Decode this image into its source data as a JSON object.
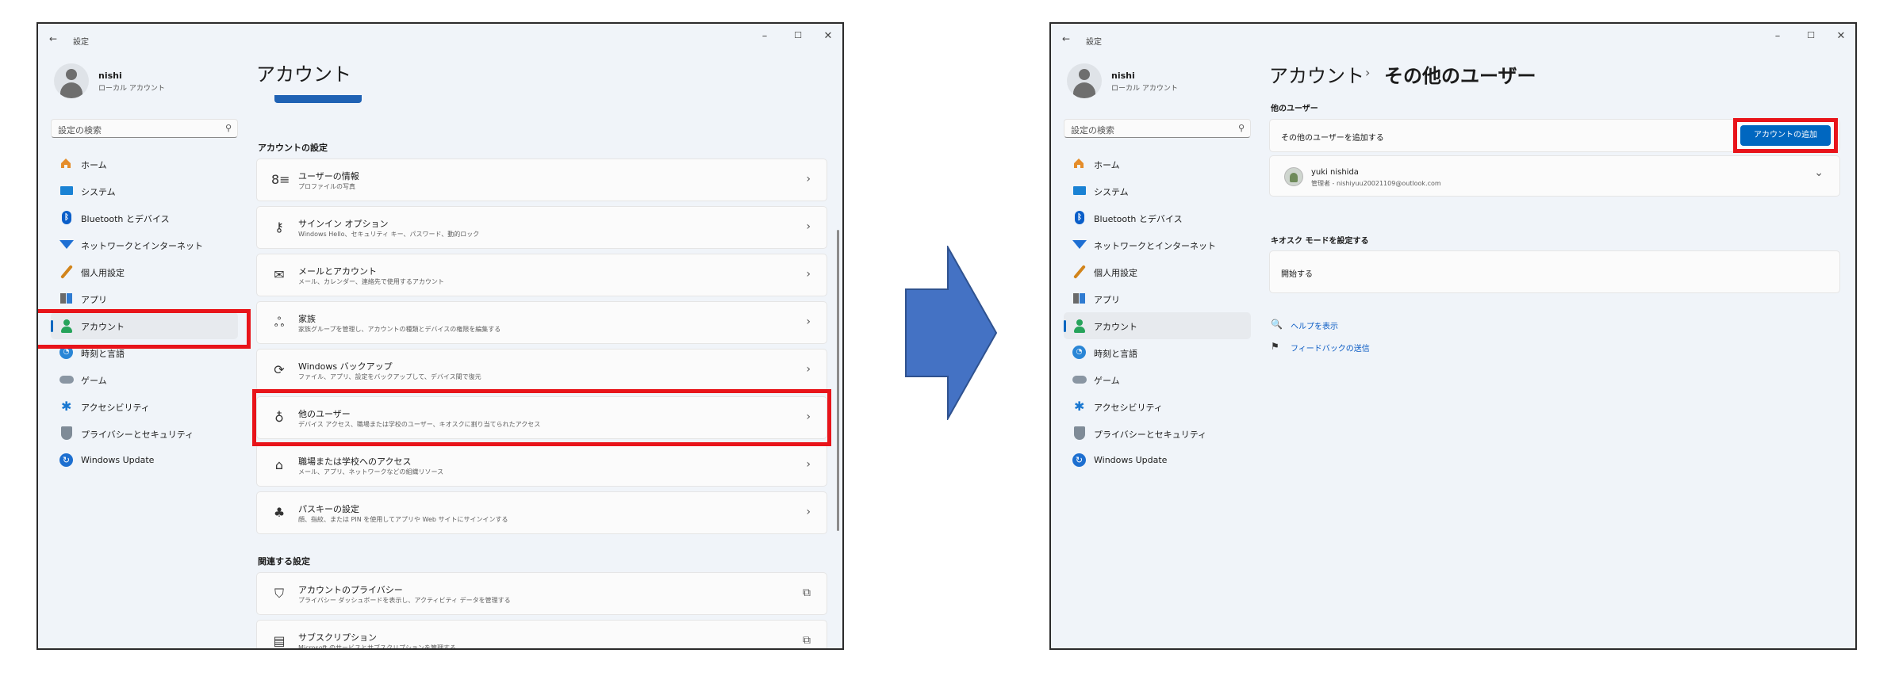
{
  "common": {
    "back_glyph": "←",
    "app_title": "設定",
    "min_glyph": "–",
    "max_glyph": "☐",
    "close_glyph": "✕",
    "user_name": "nishi",
    "user_type": "ローカル アカウント",
    "search_placeholder": "設定の検索",
    "nav": [
      {
        "label": "ホーム",
        "icon": "home-icon"
      },
      {
        "label": "システム",
        "icon": "system-icon"
      },
      {
        "label": "Bluetooth とデバイス",
        "icon": "bluetooth-icon"
      },
      {
        "label": "ネットワークとインターネット",
        "icon": "network-icon"
      },
      {
        "label": "個人用設定",
        "icon": "personalization-icon"
      },
      {
        "label": "アプリ",
        "icon": "apps-icon"
      },
      {
        "label": "アカウント",
        "icon": "accounts-icon"
      },
      {
        "label": "時刻と言語",
        "icon": "time-language-icon"
      },
      {
        "label": "ゲーム",
        "icon": "gaming-icon"
      },
      {
        "label": "アクセシビリティ",
        "icon": "accessibility-icon"
      },
      {
        "label": "プライバシーとセキュリティ",
        "icon": "privacy-shield-icon"
      },
      {
        "label": "Windows Update",
        "icon": "windows-update-icon"
      }
    ]
  },
  "left": {
    "page_title": "アカウント",
    "section_account_settings": "アカウントの設定",
    "cards": [
      {
        "title": "ユーザーの情報",
        "desc": "プロファイルの写真",
        "icon": "user-info-icon",
        "glyph": "8≡"
      },
      {
        "title": "サインイン オプション",
        "desc": "Windows Hello、セキュリティ キー、パスワード、動的ロック",
        "icon": "key-icon",
        "glyph": "⚷"
      },
      {
        "title": "メールとアカウント",
        "desc": "メール、カレンダー、連絡先で使用するアカウント",
        "icon": "mail-icon",
        "glyph": "✉"
      },
      {
        "title": "家族",
        "desc": "家族グループを管理し、アカウントの種類とデバイスの権限を編集する",
        "icon": "family-icon",
        "glyph": "ஃ"
      },
      {
        "title": "Windows バックアップ",
        "desc": "ファイル、アプリ、設定をバックアップして、デバイス間で復元",
        "icon": "backup-sync-icon",
        "glyph": "⟳"
      },
      {
        "title": "他のユーザー",
        "desc": "デバイス アクセス、職場または学校のユーザー、キオスクに割り当てられたアクセス",
        "icon": "other-users-icon",
        "glyph": "♁"
      },
      {
        "title": "職場または学校へのアクセス",
        "desc": "メール、アプリ、ネットワークなどの組織リソース",
        "icon": "briefcase-icon",
        "glyph": "⌂"
      },
      {
        "title": "パスキーの設定",
        "desc": "顔、指紋、または PIN を使用してアプリや Web サイトにサインインする",
        "icon": "passkey-icon",
        "glyph": "♣"
      }
    ],
    "section_related": "関連する設定",
    "related": [
      {
        "title": "アカウントのプライバシー",
        "desc": "プライバシー ダッシュボードを表示し、アクティビティ データを管理する",
        "icon": "shield-icon",
        "glyph": "⛉"
      },
      {
        "title": "サブスクリプション",
        "desc": "Microsoft のサービスとサブスクリプションを管理する",
        "icon": "subscription-icon",
        "glyph": "▤"
      }
    ],
    "chevron": "›",
    "external": "⧉"
  },
  "right": {
    "title_parent": "アカウント",
    "title_sep": "›",
    "title_current": "その他のユーザー",
    "section_other_users": "他のユーザー",
    "add_other_user_label": "その他のユーザーを追加する",
    "add_account_button": "アカウントの追加",
    "user_entry_name": "yuki nishida",
    "user_entry_detail": "管理者 - nishiyuu20021109@outlook.com",
    "section_kiosk": "キオスク モードを設定する",
    "kiosk_start": "開始する",
    "help_link": "ヘルプを表示",
    "feedback_link": "フィードバックの送信",
    "chevron_down": "⌄"
  },
  "colors": {
    "accent": "#0067c0",
    "highlight": "#e8141a",
    "arrow_fill": "#4472c4",
    "arrow_stroke": "#2f528f"
  }
}
